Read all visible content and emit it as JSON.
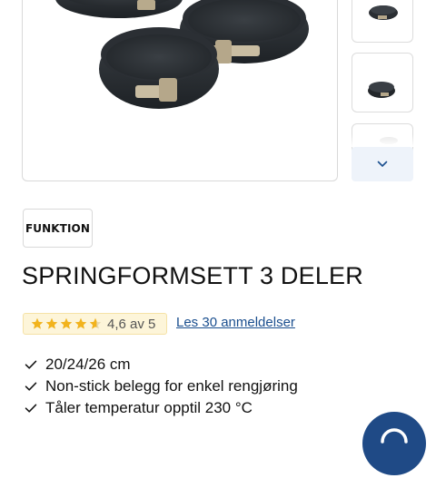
{
  "product": {
    "title": "SPRINGFORMSETT 3 DELER",
    "brand": "FUNKTION"
  },
  "rating": {
    "value": 4.6,
    "max": 5,
    "text": "4,6 av 5",
    "star_color": "#f2b31c"
  },
  "reviews_link": "Les 30 anmeldelser",
  "features": [
    "20/24/26 cm",
    "Non-stick belegg for enkel rengjøring",
    "Tåler temperatur opptil 230 °C"
  ],
  "gallery": {
    "next_icon": "chevron-down-icon"
  },
  "chat": {
    "icon": "chat-icon",
    "color": "#1f4a86"
  },
  "colors": {
    "link": "#1b4f8f",
    "rating_bg": "#fdf5d9"
  }
}
